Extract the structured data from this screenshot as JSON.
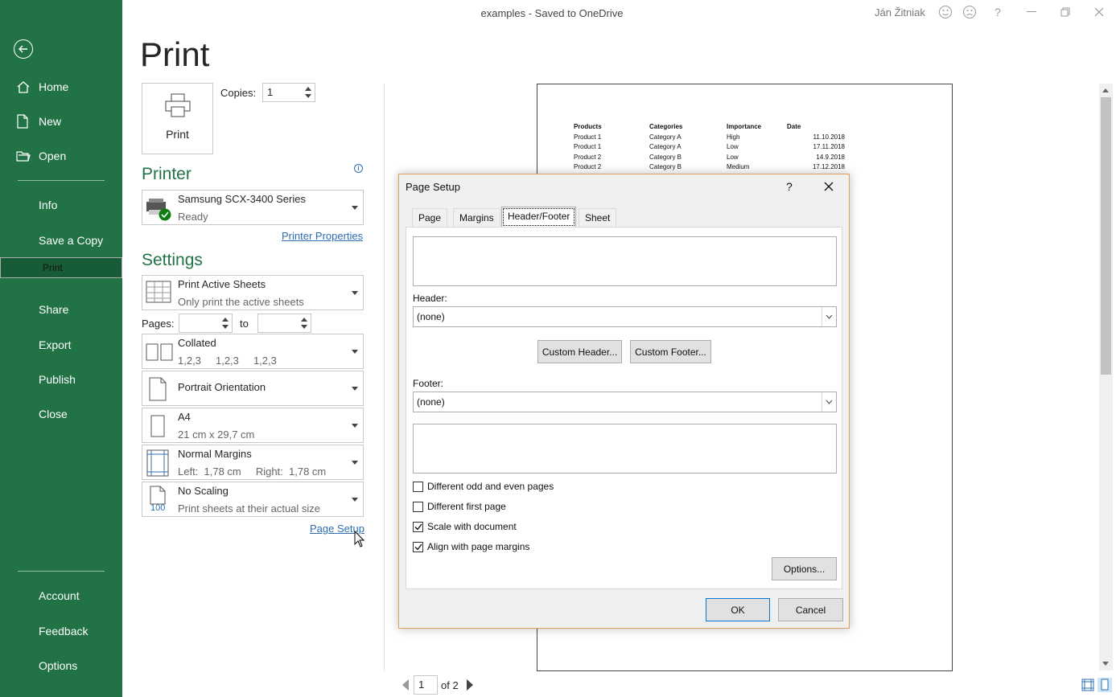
{
  "titlebar": {
    "title": "examples  -  Saved to OneDrive",
    "user": "Ján Žitniak"
  },
  "sidebar": {
    "items": [
      {
        "label": "Home"
      },
      {
        "label": "New"
      },
      {
        "label": "Open"
      },
      {
        "label": "Info"
      },
      {
        "label": "Save a Copy"
      },
      {
        "label": "Print"
      },
      {
        "label": "Share"
      },
      {
        "label": "Export"
      },
      {
        "label": "Publish"
      },
      {
        "label": "Close"
      },
      {
        "label": "Account"
      },
      {
        "label": "Feedback"
      },
      {
        "label": "Options"
      }
    ]
  },
  "print": {
    "heading": "Print",
    "button": "Print",
    "copies_label": "Copies:",
    "copies": "1",
    "printer_heading": "Printer",
    "printer_name": "Samsung SCX-3400 Series",
    "printer_status": "Ready",
    "printer_properties": "Printer Properties",
    "settings_heading": "Settings",
    "active_sheets": "Print Active Sheets",
    "active_sheets_sub": "Only print the active sheets",
    "pages_label": "Pages:",
    "to_label": "to",
    "collated": "Collated",
    "collated_sub": "1,2,3     1,2,3     1,2,3",
    "orientation": "Portrait Orientation",
    "paper": "A4",
    "paper_sub": "21 cm x 29,7 cm",
    "margins": "Normal Margins",
    "margins_sub": "Left:  1,78 cm     Right:  1,78 cm",
    "scaling": "No Scaling",
    "scaling_sub": "Print sheets at their actual size",
    "scaling_icon": "100",
    "page_setup": "Page Setup"
  },
  "preview": {
    "headers": [
      "Products",
      "Categories",
      "Importance",
      "Date"
    ],
    "rows": [
      [
        "Product 1",
        "Category A",
        "High",
        "11.10.2018"
      ],
      [
        "Product 1",
        "Category A",
        "Low",
        "17.11.2018"
      ],
      [
        "Product 2",
        "Category B",
        "Low",
        "14.9.2018"
      ],
      [
        "Product 2",
        "Category B",
        "Medium",
        "17.12.2018"
      ]
    ],
    "page": "1",
    "of": "of 2"
  },
  "dialog": {
    "title": "Page Setup",
    "help": "?",
    "tabs": [
      "Page",
      "Margins",
      "Header/Footer",
      "Sheet"
    ],
    "header_label": "Header:",
    "header_value": "(none)",
    "custom_header": "Custom Header...",
    "custom_footer": "Custom Footer...",
    "footer_label": "Footer:",
    "footer_value": "(none)",
    "checks": [
      {
        "label": "Different odd and even pages",
        "checked": false
      },
      {
        "label": "Different first page",
        "checked": false
      },
      {
        "label": "Scale with document",
        "checked": true
      },
      {
        "label": "Align with page margins",
        "checked": true
      }
    ],
    "options": "Options...",
    "ok": "OK",
    "cancel": "Cancel"
  }
}
